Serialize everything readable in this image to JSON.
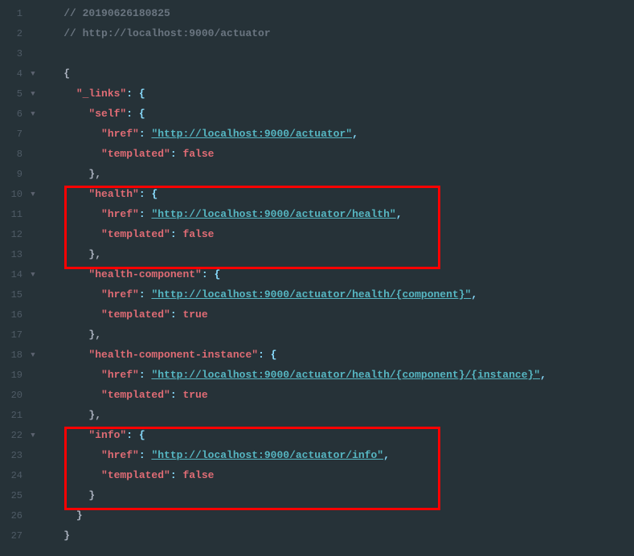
{
  "lines": {
    "l1_comment": "// 20190626180825",
    "l2_comment": "// http://localhost:9000/actuator",
    "l4_brace": "{",
    "l5_key": "\"_links\"",
    "l5_rest": ": {",
    "l6_key": "\"self\"",
    "l6_rest": ": {",
    "l7_key": "\"href\"",
    "l7_colon": ": ",
    "l7_val": "\"http://localhost:9000/actuator\"",
    "l7_comma": ",",
    "l8_key": "\"templated\"",
    "l8_colon": ": ",
    "l8_val": "false",
    "l9_close": "},",
    "l10_key": "\"health\"",
    "l10_rest": ": {",
    "l11_key": "\"href\"",
    "l11_colon": ": ",
    "l11_val": "\"http://localhost:9000/actuator/health\"",
    "l11_comma": ",",
    "l12_key": "\"templated\"",
    "l12_colon": ": ",
    "l12_val": "false",
    "l13_close": "},",
    "l14_key": "\"health-component\"",
    "l14_rest": ": {",
    "l15_key": "\"href\"",
    "l15_colon": ": ",
    "l15_val": "\"http://localhost:9000/actuator/health/{component}\"",
    "l15_comma": ",",
    "l16_key": "\"templated\"",
    "l16_colon": ": ",
    "l16_val": "true",
    "l17_close": "},",
    "l18_key": "\"health-component-instance\"",
    "l18_rest": ": {",
    "l19_key": "\"href\"",
    "l19_colon": ": ",
    "l19_val": "\"http://localhost:9000/actuator/health/{component}/{instance}\"",
    "l19_comma": ",",
    "l20_key": "\"templated\"",
    "l20_colon": ": ",
    "l20_val": "true",
    "l21_close": "},",
    "l22_key": "\"info\"",
    "l22_rest": ": {",
    "l23_key": "\"href\"",
    "l23_colon": ": ",
    "l23_val": "\"http://localhost:9000/actuator/info\"",
    "l23_comma": ",",
    "l24_key": "\"templated\"",
    "l24_colon": ": ",
    "l24_val": "false",
    "l25_close": "}",
    "l26_close": "}",
    "l27_close": "}"
  },
  "nums": {
    "n1": "1",
    "n2": "2",
    "n3": "3",
    "n4": "4",
    "n5": "5",
    "n6": "6",
    "n7": "7",
    "n8": "8",
    "n9": "9",
    "n10": "10",
    "n11": "11",
    "n12": "12",
    "n13": "13",
    "n14": "14",
    "n15": "15",
    "n16": "16",
    "n17": "17",
    "n18": "18",
    "n19": "19",
    "n20": "20",
    "n21": "21",
    "n22": "22",
    "n23": "23",
    "n24": "24",
    "n25": "25",
    "n26": "26",
    "n27": "27"
  }
}
